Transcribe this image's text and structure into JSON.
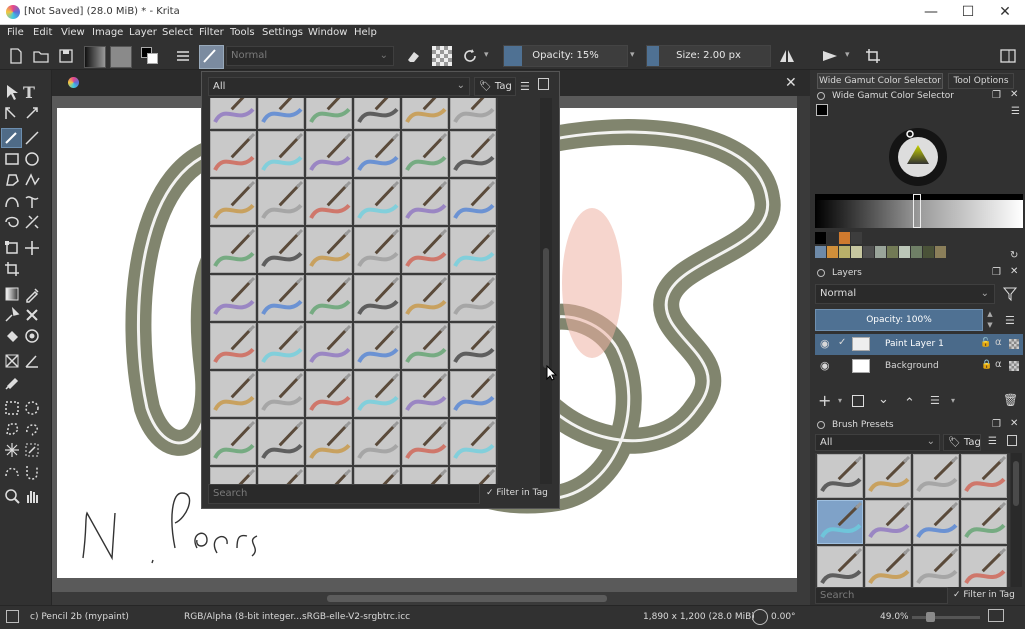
{
  "window": {
    "title": "[Not Saved]  (28.0 MiB)  * - Krita",
    "minimize": "—",
    "maximize": "☐",
    "close": "✕"
  },
  "menu": [
    "File",
    "Edit",
    "View",
    "Image",
    "Layer",
    "Select",
    "Filter",
    "Tools",
    "Settings",
    "Window",
    "Help"
  ],
  "toolbar": {
    "blend_mode": "Normal",
    "opacity_label": "Opacity: 15%",
    "opacity_value": 0.15,
    "size_label": "Size: 2.00 px",
    "size_value": 0.05
  },
  "popup": {
    "tag_filter": "All",
    "tag_button": "Tag",
    "search_placeholder": "Search",
    "filter_in_tag": "Filter in Tag",
    "close": "✕"
  },
  "right_panel": {
    "tab_color": "Wide Gamut Color Selector",
    "tab_tool": "Tool Options",
    "color_title": "Wide Gamut Color Selector",
    "layers_title": "Layers",
    "layer_blend": "Normal",
    "layer_opacity": "Opacity:  100%",
    "layers": [
      {
        "name": "Paint Layer 1",
        "selected": true
      },
      {
        "name": "Background",
        "selected": false
      }
    ],
    "presets_title": "Brush Presets",
    "presets_filter": "All",
    "presets_tag": "Tag",
    "presets_search": "Search",
    "presets_filter_in_tag": "Filter in Tag",
    "swatches": [
      "#000000",
      "#2e2e2e",
      "#cf7a2e",
      "#3d3d3d",
      "#6e8aa8",
      "#d08f3a",
      "#b9b06a",
      "#c7c7a0",
      "#4f4f4f",
      "#9aa59a",
      "#727a55",
      "#bcc7b8",
      "#6f7f66",
      "#4a5238",
      "#8b7f5a"
    ]
  },
  "status": {
    "brush": "c) Pencil 2b (mypaint)",
    "color_space": "RGB/Alpha (8-bit integer...sRGB-elle-V2-srgbtrc.icc",
    "dimensions": "1,890 x 1,200 (28.0 MiB)",
    "rotation": "0.00°",
    "zoom": "49.0%"
  },
  "colors": {
    "accent": "#4f7193",
    "stroke": "#6b7055",
    "fg": "#000000",
    "bg": "#ffffff"
  }
}
